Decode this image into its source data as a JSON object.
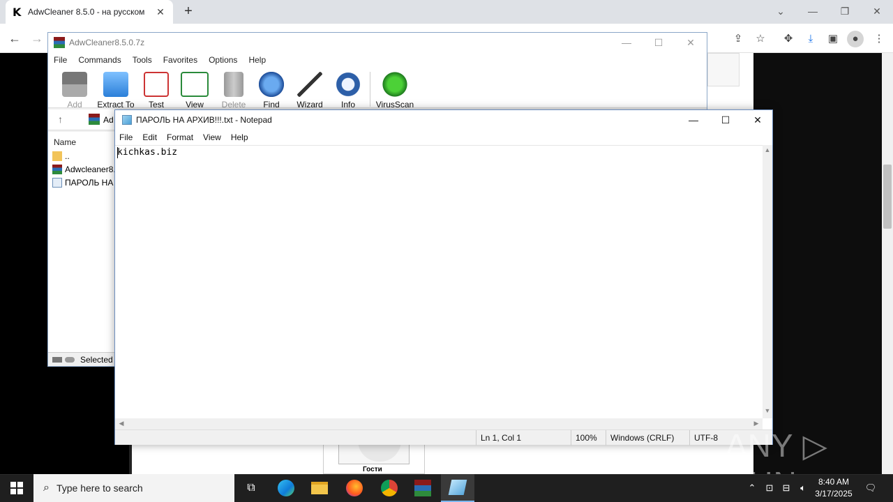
{
  "browser": {
    "tab_favicon": "K",
    "tab_title": "AdwCleaner 8.5.0 - на русском",
    "tab_close": "✕",
    "new_tab": "+",
    "minimize": "—",
    "maximize": "❐",
    "close": "✕",
    "chevron": "⌄"
  },
  "web": {
    "guest_label": "Гости"
  },
  "winrar": {
    "title": "AdwCleaner8.5.0.7z",
    "menu": [
      "File",
      "Commands",
      "Tools",
      "Favorites",
      "Options",
      "Help"
    ],
    "tools": [
      {
        "label": "Add",
        "disabled": true
      },
      {
        "label": "Extract To"
      },
      {
        "label": "Test"
      },
      {
        "label": "View"
      },
      {
        "label": "Delete",
        "disabled": true
      },
      {
        "label": "Find"
      },
      {
        "label": "Wizard"
      },
      {
        "label": "Info"
      },
      {
        "label": "VirusScan"
      }
    ],
    "address_text": "Ad",
    "column_name": "Name",
    "rows": [
      "..",
      "Adwcleaner8.",
      "ПАРОЛЬ НА"
    ],
    "status": "Selected"
  },
  "notepad": {
    "title": "ПАРОЛЬ НА АРХИВ!!!.txt - Notepad",
    "menu": [
      "File",
      "Edit",
      "Format",
      "View",
      "Help"
    ],
    "content": "kichkas.biz",
    "status": {
      "position": "Ln 1, Col 1",
      "zoom": "100%",
      "line_ending": "Windows (CRLF)",
      "encoding": "UTF-8"
    }
  },
  "watermark": "ANY ▷ RUN",
  "taskbar": {
    "search_placeholder": "Type here to search",
    "time": "8:40 AM",
    "date": "3/17/2025"
  }
}
